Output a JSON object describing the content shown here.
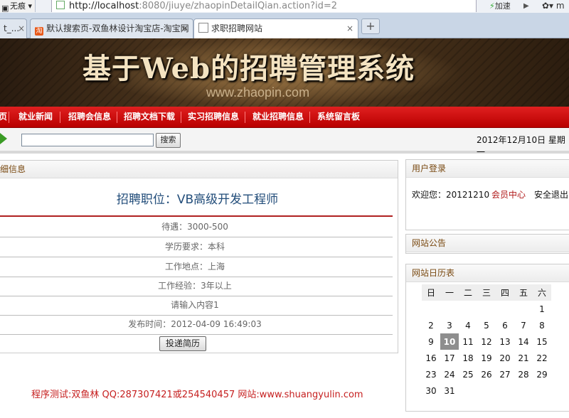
{
  "browser": {
    "no_source_label": "无痕",
    "url_host": "http://localhost",
    "url_rest": ":8080/jiuye/zhaopinDetailQian.action?id=2",
    "accelerate_label": "加速",
    "extra_label": "m",
    "tabs": [
      {
        "title": "t_..."
      },
      {
        "title": "默认搜索页-双鱼林设计淘宝店-淘宝网"
      },
      {
        "title": "求职招聘网站"
      }
    ],
    "new_tab": "+",
    "close": "×"
  },
  "site": {
    "title": "基于Web的招聘管理系统",
    "url": "www.zhaopin.com"
  },
  "nav": {
    "items": [
      {
        "label": "页"
      },
      {
        "label": "就业新闻"
      },
      {
        "label": "招聘会信息"
      },
      {
        "label": "招聘文档下载"
      },
      {
        "label": "实习招聘信息"
      },
      {
        "label": "就业招聘信息"
      },
      {
        "label": "系统留言板"
      }
    ]
  },
  "search": {
    "value": "",
    "button": "搜索",
    "date": "2012年12月10日  星期一"
  },
  "detail": {
    "section_title": "细信息",
    "job_title": "招聘职位：VB高级开发工程师",
    "rows": [
      {
        "text": "待遇：3000-500"
      },
      {
        "text": "学历要求：本科"
      },
      {
        "text": "工作地点：上海"
      },
      {
        "text": "工作经验：3年以上"
      },
      {
        "text": "请输入内容1"
      },
      {
        "text": "发布时间：2012-04-09 16:49:03"
      }
    ],
    "apply_button": "投递简历"
  },
  "footer": "程序测试:双鱼林 QQ:287307421或254540457 网站:www.shuangyulin.com",
  "login": {
    "title": "用户登录",
    "welcome": "欢迎您：20121210",
    "member_center": "会员中心",
    "logout": "安全退出"
  },
  "notice": {
    "title": "网站公告"
  },
  "calendar": {
    "title": "网站日历表",
    "weekdays": [
      "日",
      "一",
      "二",
      "三",
      "四",
      "五",
      "六"
    ],
    "weeks": [
      [
        "",
        "",
        "",
        "",
        "",
        "",
        "1"
      ],
      [
        "2",
        "3",
        "4",
        "5",
        "6",
        "7",
        "8"
      ],
      [
        "9",
        "10",
        "11",
        "12",
        "13",
        "14",
        "15"
      ],
      [
        "16",
        "17",
        "18",
        "19",
        "20",
        "21",
        "22"
      ],
      [
        "23",
        "24",
        "25",
        "26",
        "27",
        "28",
        "29"
      ],
      [
        "30",
        "31",
        "",
        "",
        "",
        "",
        ""
      ]
    ],
    "today": "10"
  },
  "colors": {
    "nav_red": "#d01010",
    "accent_brown": "#7a4a12",
    "footer_red": "#c62020",
    "title_blue": "#224d7a"
  }
}
